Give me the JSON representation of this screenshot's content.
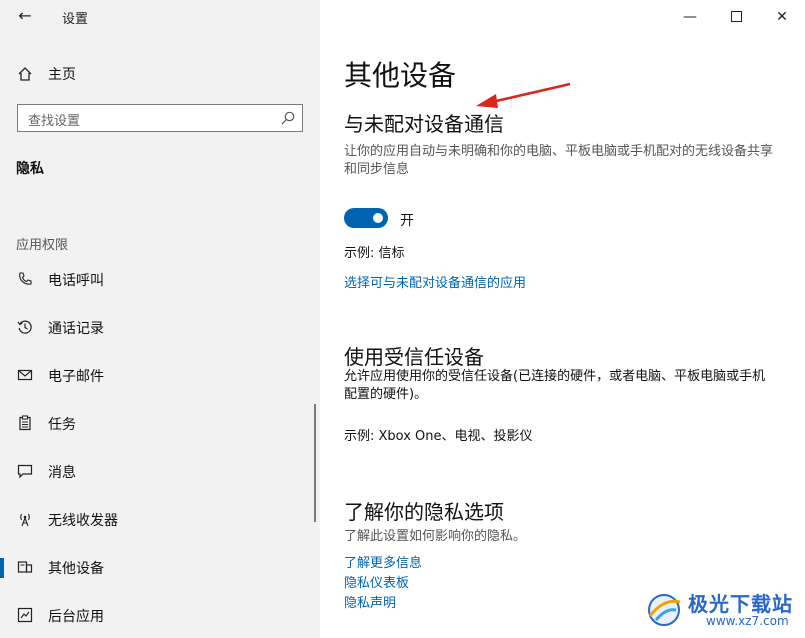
{
  "window": {
    "title": "设置",
    "controls": [
      "minimize",
      "maximize",
      "close"
    ]
  },
  "sidebar": {
    "home_label": "主页",
    "search_placeholder": "查找设置",
    "section_title": "隐私",
    "subsection_title": "应用权限",
    "items": [
      {
        "label": "电话呼叫",
        "icon": "phone-icon"
      },
      {
        "label": "通话记录",
        "icon": "call-history-icon"
      },
      {
        "label": "电子邮件",
        "icon": "mail-icon"
      },
      {
        "label": "任务",
        "icon": "tasks-icon"
      },
      {
        "label": "消息",
        "icon": "message-icon"
      },
      {
        "label": "无线收发器",
        "icon": "radio-icon"
      },
      {
        "label": "其他设备",
        "icon": "other-devices-icon",
        "active": true
      },
      {
        "label": "后台应用",
        "icon": "background-apps-icon"
      }
    ]
  },
  "main": {
    "title": "其他设备",
    "unpaired": {
      "heading": "与未配对设备通信",
      "description": "让你的应用自动与未明确和你的电脑、平板电脑或手机配对的无线设备共享和同步信息",
      "toggle_state": "开",
      "example": "示例: 信标",
      "link": "选择可与未配对设备通信的应用"
    },
    "trusted": {
      "heading": "使用受信任设备",
      "description": "允许应用使用你的受信任设备(已连接的硬件，或者电脑、平板电脑或手机配置的硬件)。",
      "example": "示例: Xbox One、电视、投影仪"
    },
    "privacy": {
      "heading": "了解你的隐私选项",
      "description": "了解此设置如何影响你的隐私。",
      "links": [
        "了解更多信息",
        "隐私仪表板",
        "隐私声明"
      ]
    }
  },
  "watermark": {
    "text": "极光下载站",
    "url": "www.xz7.com"
  },
  "colors": {
    "accent": "#0063b1",
    "sidebar_bg": "#f2f2f2",
    "arrow": "#d9261c"
  }
}
